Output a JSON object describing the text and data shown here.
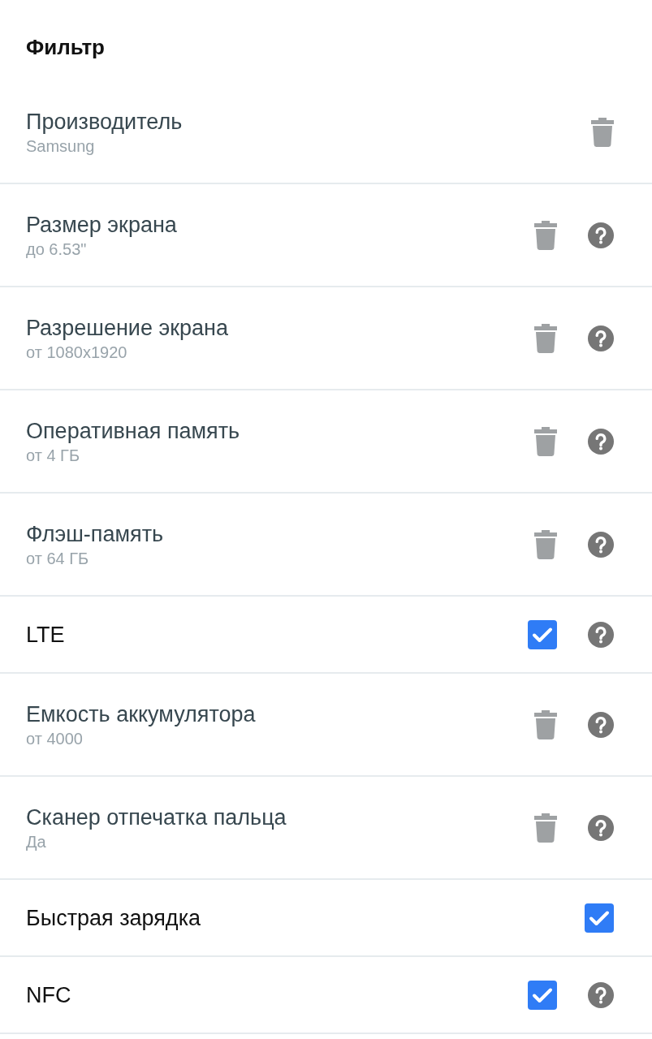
{
  "header": {
    "title": "Фильтр"
  },
  "filters": [
    {
      "kind": "value",
      "label": "Производитель",
      "value": "Samsung",
      "help": false
    },
    {
      "kind": "value",
      "label": "Размер экрана",
      "value": "до 6.53\"",
      "help": true
    },
    {
      "kind": "value",
      "label": "Разрешение экрана",
      "value": "от 1080x1920",
      "help": true
    },
    {
      "kind": "value",
      "label": "Оперативная память",
      "value": "от 4 ГБ",
      "help": true
    },
    {
      "kind": "value",
      "label": "Флэш-память",
      "value": "от 64 ГБ",
      "help": true
    },
    {
      "kind": "toggle",
      "label": "LTE",
      "checked": true,
      "help": true
    },
    {
      "kind": "value",
      "label": "Емкость аккумулятора",
      "value": "от 4000",
      "help": true
    },
    {
      "kind": "value",
      "label": "Сканер отпечатка пальца",
      "value": "Да",
      "help": true
    },
    {
      "kind": "toggle",
      "label": "Быстрая зарядка",
      "checked": true,
      "help": false
    },
    {
      "kind": "toggle",
      "label": "NFC",
      "checked": true,
      "help": true
    }
  ]
}
